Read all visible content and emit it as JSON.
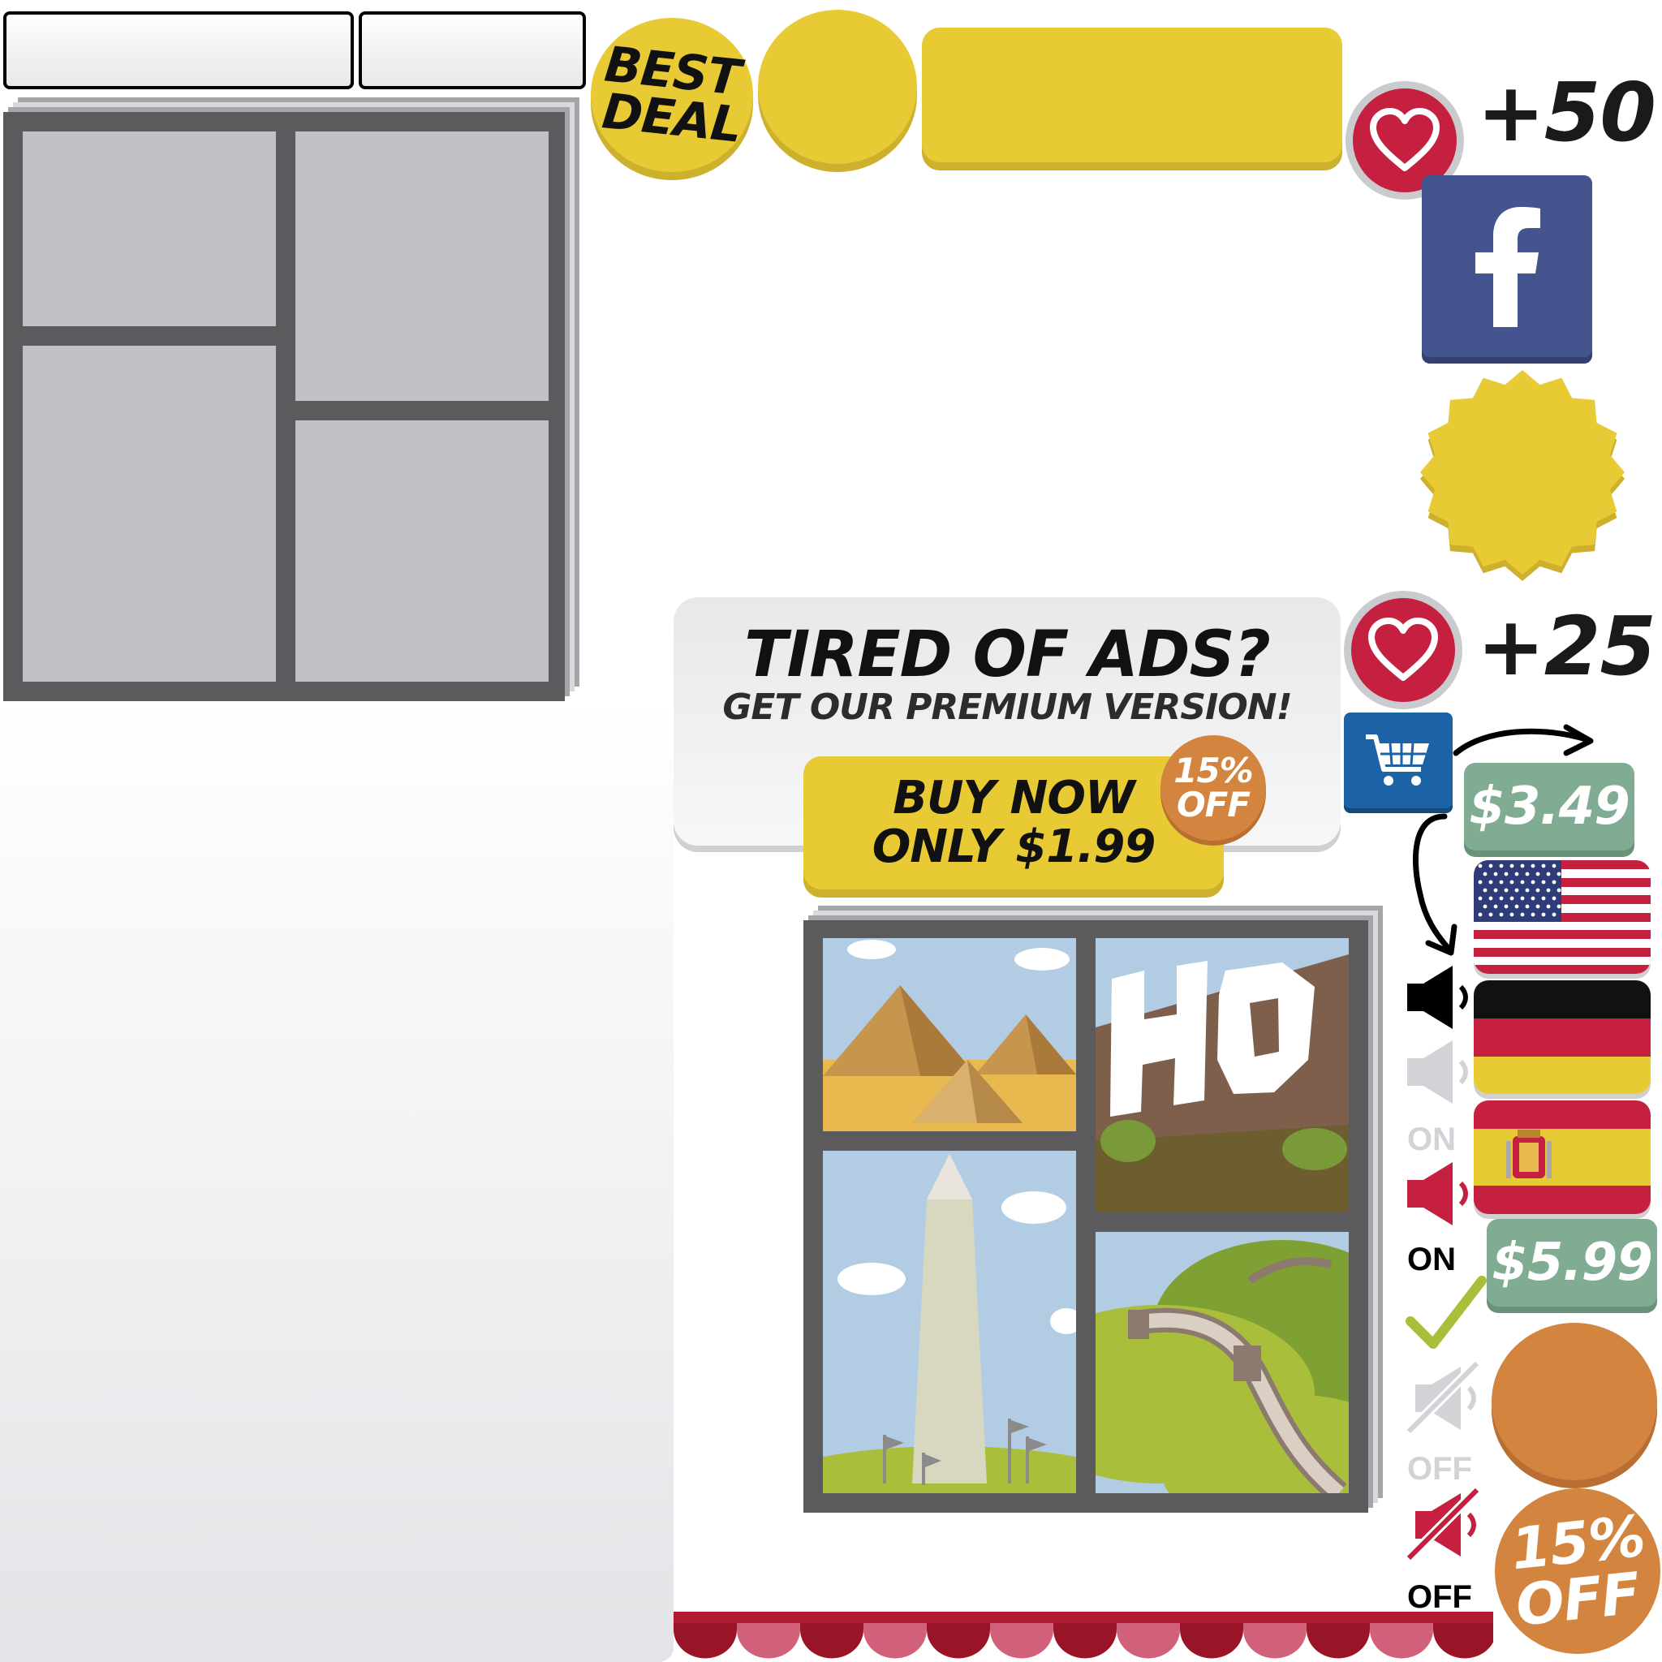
{
  "tabs": [
    {
      "label": ""
    },
    {
      "label": ""
    }
  ],
  "best_deal": {
    "line1": "BEST",
    "line2": "DEAL"
  },
  "hearts": [
    {
      "reward": "+50"
    },
    {
      "reward": "+25"
    }
  ],
  "promo": {
    "headline": "TIRED OF ADS?",
    "subheadline": "GET OUR PREMIUM VERSION!",
    "buy_line1": "BUY NOW",
    "buy_line2": "ONLY $1.99",
    "discount_line1": "15%",
    "discount_line2": "OFF"
  },
  "prices": [
    "$3.49",
    "$5.99"
  ],
  "sound_labels": {
    "on_grey": "ON",
    "on_black": "ON",
    "off_grey": "OFF",
    "off_black": "OFF"
  },
  "big_discount": {
    "line1": "15%",
    "line2": "OFF"
  },
  "flags": [
    "us-flag",
    "germany-flag",
    "spain-flag"
  ],
  "colors": {
    "yellow": "#e8ca34",
    "red": "#c5203f",
    "facebook": "#43548f",
    "orange": "#d38540",
    "price_green": "#7fac93",
    "cart_blue": "#1b62a7",
    "frame_grey": "#5b5b5d"
  }
}
